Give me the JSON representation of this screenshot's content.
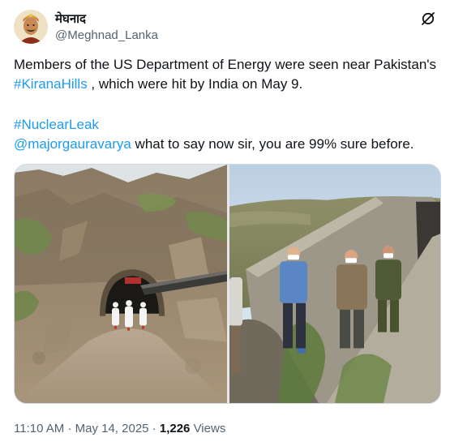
{
  "author": {
    "display_name": "मेघनाद",
    "handle": "@Meghnad_Lanka"
  },
  "tweet": {
    "line1_prefix": "Members of the US Department of Energy were seen near Pakistan's ",
    "line1_hashtag": "#KiranaHills",
    "line1_suffix": " , which were hit by India on May 9.",
    "hashtag2": "#NuclearLeak",
    "mention": "@majorgauravarya",
    "line3_suffix": " what to say now sir, you are 99% sure before."
  },
  "media": {
    "left_photo_icon": "tunnel-photo",
    "right_photo_icon": "bunker-photo"
  },
  "meta": {
    "time": "11:10 AM",
    "sep1": " · ",
    "date": "May 14, 2025",
    "sep2": " · ",
    "views_count": "1,226",
    "views_label": " Views"
  },
  "icons": {
    "grok": "grok-icon"
  },
  "colors": {
    "link": "#1d9bf0",
    "text": "#0f1419",
    "secondary": "#536471"
  }
}
